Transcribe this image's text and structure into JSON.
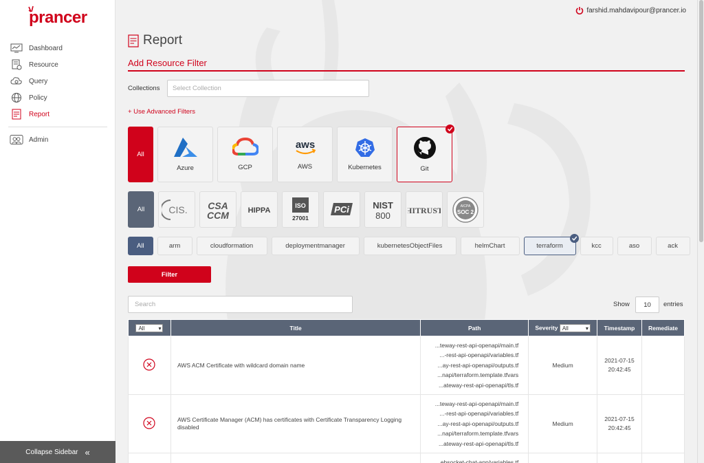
{
  "app": {
    "logo": "prancer",
    "brand_color": "#d0021b"
  },
  "sidebar": {
    "items": [
      {
        "label": "Dashboard",
        "icon": "dashboard-icon"
      },
      {
        "label": "Resource",
        "icon": "resource-icon"
      },
      {
        "label": "Query",
        "icon": "query-icon"
      },
      {
        "label": "Policy",
        "icon": "policy-icon"
      },
      {
        "label": "Report",
        "icon": "report-icon",
        "active": true
      }
    ],
    "admin": {
      "label": "Admin",
      "icon": "admin-icon"
    },
    "collapse_label": "Collapse Sidebar"
  },
  "header": {
    "user_email": "farshid.mahdavipour@prancer.io"
  },
  "page": {
    "title": "Report",
    "section_title": "Add Resource Filter",
    "collections_label": "Collections",
    "collections_placeholder": "Select Collection",
    "advanced_filters": "+ Use Advanced Filters"
  },
  "providers": {
    "all_label": "All",
    "items": [
      {
        "label": "Azure",
        "selected": false
      },
      {
        "label": "GCP",
        "selected": false
      },
      {
        "label": "AWS",
        "selected": false
      },
      {
        "label": "Kubernetes",
        "selected": false
      },
      {
        "label": "Git",
        "selected": true
      }
    ]
  },
  "compliance": {
    "all_label": "All",
    "items": [
      {
        "name": "cis-logo",
        "text": "CIS."
      },
      {
        "name": "csa-ccm-logo",
        "text": "CSA CCM"
      },
      {
        "name": "hippa-logo",
        "text": "HIPPA"
      },
      {
        "name": "iso-27001-logo",
        "text": "ISO 27001"
      },
      {
        "name": "pci-logo",
        "text": "PCI"
      },
      {
        "name": "nist-800-logo",
        "text": "NIST 800"
      },
      {
        "name": "hitrust-logo",
        "text": "HITRUST"
      },
      {
        "name": "aicpa-soc2-logo",
        "text": "AICPA SOC 2"
      }
    ]
  },
  "types": {
    "all_label": "All",
    "items": [
      "arm",
      "cloudformation",
      "deploymentmanager",
      "kubernetesObjectFiles",
      "helmChart",
      "terraform",
      "kcc",
      "aso",
      "ack"
    ],
    "selected": "terraform"
  },
  "filter_button": "Filter",
  "search_placeholder": "Search",
  "pagination": {
    "show_label": "Show",
    "entries_value": "10",
    "entries_label": "entries"
  },
  "table": {
    "headers": {
      "status_select": "All",
      "title": "Title",
      "path": "Path",
      "severity": "Severity",
      "severity_select": "All",
      "timestamp": "Timestamp",
      "remediate": "Remediate"
    },
    "rows": [
      {
        "title": "AWS ACM Certificate with wildcard domain name",
        "paths": [
          "...teway-rest-api-openapi/main.tf",
          "...-rest-api-openapi/variables.tf",
          "...ay-rest-api-openapi/outputs.tf",
          "...napi/terraform.template.tfvars",
          "...ateway-rest-api-openapi/tls.tf"
        ],
        "severity": "Medium",
        "date": "2021-07-15",
        "time": "20:42:45"
      },
      {
        "title": "AWS Certificate Manager (ACM) has certificates with Certificate Transparency Logging disabled",
        "paths": [
          "...teway-rest-api-openapi/main.tf",
          "...-rest-api-openapi/variables.tf",
          "...ay-rest-api-openapi/outputs.tf",
          "...napi/terraform.template.tfvars",
          "...ateway-rest-api-openapi/tls.tf"
        ],
        "severity": "Medium",
        "date": "2021-07-15",
        "time": "20:42:45"
      },
      {
        "title": "",
        "paths": [
          "...ebsocket-chat-app/variables.tf"
        ],
        "severity": "",
        "date": "",
        "time": ""
      }
    ]
  }
}
